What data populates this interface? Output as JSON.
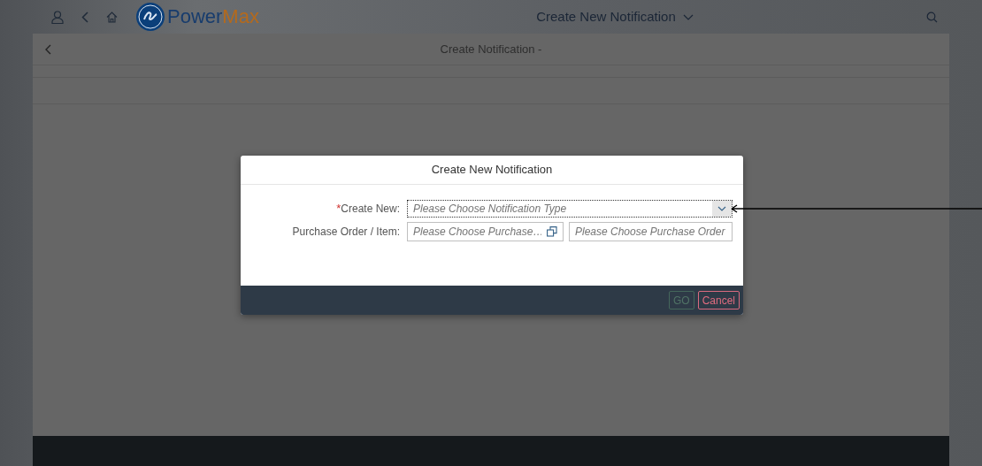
{
  "shell": {
    "brand": {
      "part_1": "Power",
      "part_2": "Max"
    },
    "title": "Create New Notification"
  },
  "page": {
    "title": "Create Notification -"
  },
  "dialog": {
    "title": "Create New Notification",
    "fields": [
      {
        "label": "Create New:",
        "required_mark": "*",
        "kind": "select",
        "placeholder": "Please Choose Notification Type",
        "focused": true
      },
      {
        "label": "Purchase Order / Item:",
        "kind": "pair",
        "placeholder": "Please Choose Purchase…",
        "placeholder_2": "Please Choose Purchase Order",
        "focused": false
      }
    ],
    "buttons": [
      {
        "label": "GO",
        "kind": "go",
        "disabled": true
      },
      {
        "label": "Cancel",
        "kind": "cancel",
        "disabled": false
      }
    ]
  }
}
